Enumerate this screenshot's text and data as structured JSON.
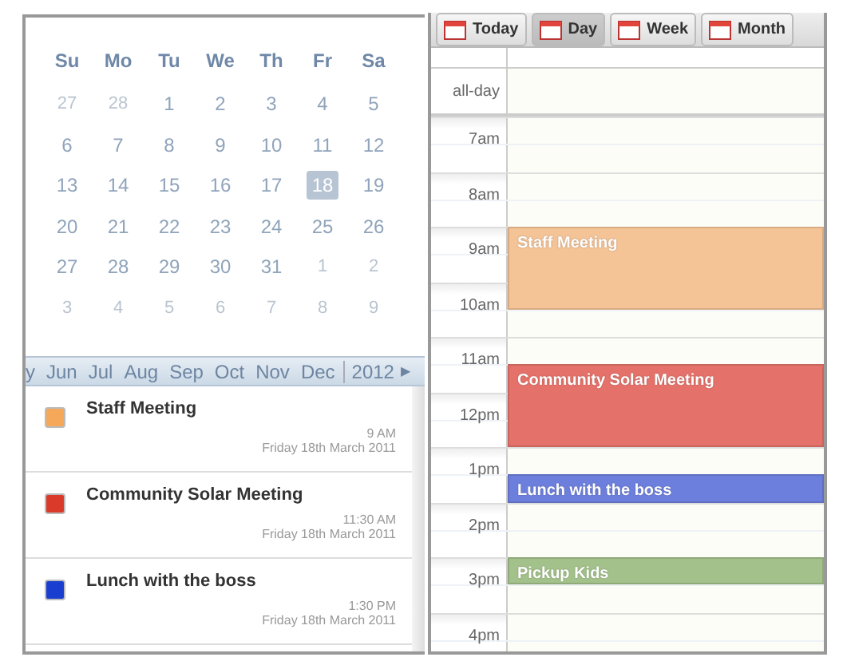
{
  "mini_calendar": {
    "weekdays": [
      "Su",
      "Mo",
      "Tu",
      "We",
      "Th",
      "Fr",
      "Sa"
    ],
    "weeks": [
      [
        {
          "day": "27",
          "kind": "other",
          "selected": false
        },
        {
          "day": "28",
          "kind": "other",
          "selected": false
        },
        {
          "day": "1",
          "kind": "current",
          "selected": false
        },
        {
          "day": "2",
          "kind": "current",
          "selected": false
        },
        {
          "day": "3",
          "kind": "current",
          "selected": false
        },
        {
          "day": "4",
          "kind": "current",
          "selected": false
        },
        {
          "day": "5",
          "kind": "current",
          "selected": false
        }
      ],
      [
        {
          "day": "6",
          "kind": "current",
          "selected": false
        },
        {
          "day": "7",
          "kind": "current",
          "selected": false
        },
        {
          "day": "8",
          "kind": "current",
          "selected": false
        },
        {
          "day": "9",
          "kind": "current",
          "selected": false
        },
        {
          "day": "10",
          "kind": "current",
          "selected": false
        },
        {
          "day": "11",
          "kind": "current",
          "selected": false
        },
        {
          "day": "12",
          "kind": "current",
          "selected": false
        }
      ],
      [
        {
          "day": "13",
          "kind": "current",
          "selected": false
        },
        {
          "day": "14",
          "kind": "current",
          "selected": false
        },
        {
          "day": "15",
          "kind": "current",
          "selected": false
        },
        {
          "day": "16",
          "kind": "current",
          "selected": false
        },
        {
          "day": "17",
          "kind": "current",
          "selected": false
        },
        {
          "day": "18",
          "kind": "current",
          "selected": true
        },
        {
          "day": "19",
          "kind": "current",
          "selected": false
        }
      ],
      [
        {
          "day": "20",
          "kind": "current",
          "selected": false
        },
        {
          "day": "21",
          "kind": "current",
          "selected": false
        },
        {
          "day": "22",
          "kind": "current",
          "selected": false
        },
        {
          "day": "23",
          "kind": "current",
          "selected": false
        },
        {
          "day": "24",
          "kind": "current",
          "selected": false
        },
        {
          "day": "25",
          "kind": "current",
          "selected": false
        },
        {
          "day": "26",
          "kind": "current",
          "selected": false
        }
      ],
      [
        {
          "day": "27",
          "kind": "current",
          "selected": false
        },
        {
          "day": "28",
          "kind": "current",
          "selected": false
        },
        {
          "day": "29",
          "kind": "current",
          "selected": false
        },
        {
          "day": "30",
          "kind": "current",
          "selected": false
        },
        {
          "day": "31",
          "kind": "current",
          "selected": false
        },
        {
          "day": "1",
          "kind": "other",
          "selected": false
        },
        {
          "day": "2",
          "kind": "other",
          "selected": false
        }
      ],
      [
        {
          "day": "3",
          "kind": "other",
          "selected": false
        },
        {
          "day": "4",
          "kind": "other",
          "selected": false
        },
        {
          "day": "5",
          "kind": "other",
          "selected": false
        },
        {
          "day": "6",
          "kind": "other",
          "selected": false
        },
        {
          "day": "7",
          "kind": "other",
          "selected": false
        },
        {
          "day": "8",
          "kind": "other",
          "selected": false
        },
        {
          "day": "9",
          "kind": "other",
          "selected": false
        }
      ]
    ]
  },
  "month_strip": {
    "months": [
      "y",
      "Jun",
      "Jul",
      "Aug",
      "Sep",
      "Oct",
      "Nov",
      "Dec"
    ],
    "year": "2012",
    "arrow": "▶"
  },
  "event_list": [
    {
      "title": "Staff Meeting",
      "color": "#f5a85a",
      "time": "9 AM",
      "date": "Friday 18th March 2011"
    },
    {
      "title": "Community Solar Meeting",
      "color": "#d93a2a",
      "time": "11:30 AM",
      "date": "Friday 18th March 2011"
    },
    {
      "title": "Lunch with the boss",
      "color": "#1a3fd0",
      "time": "1:30 PM",
      "date": "Friday 18th March 2011"
    }
  ],
  "toolbar": [
    {
      "label": "Today",
      "selected": false
    },
    {
      "label": "Day",
      "selected": true
    },
    {
      "label": "Week",
      "selected": false
    },
    {
      "label": "Month",
      "selected": false
    }
  ],
  "day_view": {
    "all_day_label": "all-day",
    "rows": [
      {
        "kind": "hour",
        "label": "7am"
      },
      {
        "kind": "half"
      },
      {
        "kind": "hour",
        "label": "8am"
      },
      {
        "kind": "half"
      },
      {
        "kind": "hour",
        "label": "9am",
        "event": "Staff Meeting",
        "color": "#f4c396"
      },
      {
        "kind": "half",
        "color": "#f4c396"
      },
      {
        "kind": "hour",
        "label": "10am",
        "color": "#f4c396"
      },
      {
        "kind": "half"
      },
      {
        "kind": "hour",
        "label": "11am"
      },
      {
        "kind": "half",
        "event": "Community Solar Meeting",
        "color": "#e5726a"
      },
      {
        "kind": "hour",
        "label": "12pm",
        "color": "#e5726a"
      },
      {
        "kind": "half",
        "color": "#e5726a"
      },
      {
        "kind": "hour",
        "label": "1pm"
      },
      {
        "kind": "half",
        "event": "Lunch with the boss",
        "color": "#6d7fdc"
      },
      {
        "kind": "hour",
        "label": "2pm"
      },
      {
        "kind": "half"
      },
      {
        "kind": "hour",
        "label": "3pm",
        "event": "Pickup Kids",
        "color": "#a3c18a"
      },
      {
        "kind": "half"
      },
      {
        "kind": "hour",
        "label": "4pm"
      },
      {
        "kind": "half"
      }
    ]
  }
}
